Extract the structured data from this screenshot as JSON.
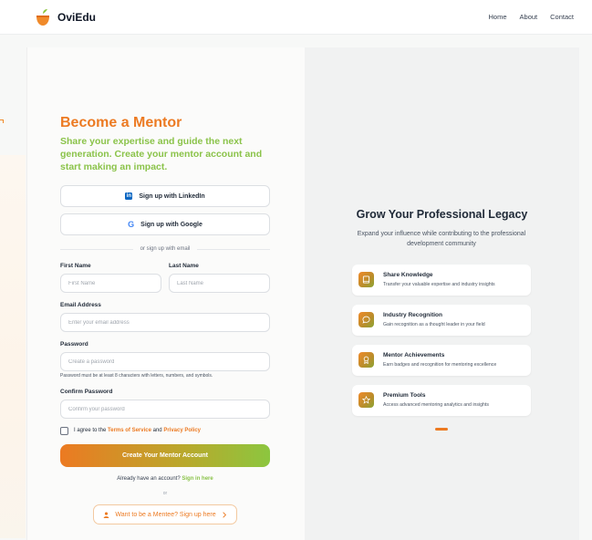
{
  "header": {
    "brand": "OviEdu",
    "nav": [
      "Home",
      "About",
      "Contact"
    ]
  },
  "form": {
    "title": "Become a Mentor",
    "subtitle": "Share your expertise and guide the next generation. Create your mentor account and start making an impact.",
    "linkedin_label": "Sign up with LinkedIn",
    "google_label": "Sign up with Google",
    "divider": "or sign up with email",
    "first_name": {
      "label": "First Name",
      "placeholder": "First Name",
      "value": ""
    },
    "last_name": {
      "label": "Last Name",
      "placeholder": "Last Name",
      "value": ""
    },
    "email": {
      "label": "Email Address",
      "placeholder": "Enter your email address",
      "value": ""
    },
    "password": {
      "label": "Password",
      "placeholder": "Create a password",
      "value": ""
    },
    "password_hint": "Password must be at least 8 characters with letters, numbers, and symbols.",
    "confirm_password": {
      "label": "Confirm Password",
      "placeholder": "Confirm your password",
      "value": ""
    },
    "agree_prefix": "I agree to the",
    "terms_link": "Terms of Service",
    "agree_and": "and",
    "privacy_link": "Privacy Policy",
    "agree_checked": false,
    "submit_label": "Create Your Mentor Account",
    "have_account": "Already have an account?",
    "sign_in_link": "Sign in here",
    "or_small": "or",
    "mentee_label": "Want to be a Mentee? Sign up here"
  },
  "promo": {
    "title": "Grow Your Professional Legacy",
    "subtitle": "Expand your influence while contributing to the professional development community",
    "features": [
      {
        "icon": "book-icon",
        "title": "Share Knowledge",
        "desc": "Transfer your valuable expertise and industry insights"
      },
      {
        "icon": "speech-bubble-icon",
        "title": "Industry Recognition",
        "desc": "Gain recognition as a thought leader in your field"
      },
      {
        "icon": "award-icon",
        "title": "Mentor Achievements",
        "desc": "Earn badges and recognition for mentoring excellence"
      },
      {
        "icon": "star-icon",
        "title": "Premium Tools",
        "desc": "Access advanced mentoring analytics and insights"
      }
    ]
  },
  "colors": {
    "accent_orange": "#ec7a22",
    "accent_green": "#8bc34a",
    "linkedin_blue": "#0a66c2"
  }
}
